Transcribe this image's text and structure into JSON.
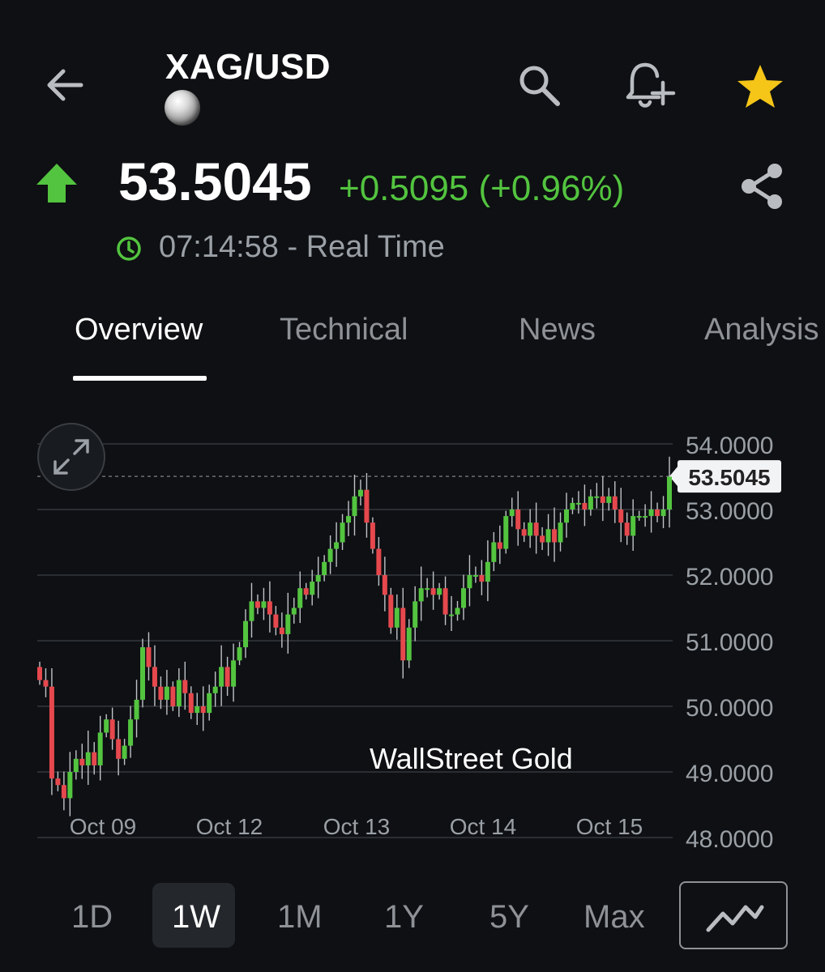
{
  "header": {
    "title": "XAG/USD",
    "back_icon": "arrow-left-icon",
    "search_icon": "search-icon",
    "alert_icon": "bell-plus-icon",
    "favorite_icon": "star-icon"
  },
  "quote": {
    "price": "53.5045",
    "change": "+0.5095 (+0.96%)",
    "timestamp": "07:14:58 - Real Time",
    "direction_icon": "arrow-up-icon",
    "up_color": "#53c43f"
  },
  "tabs": [
    {
      "label": "Overview",
      "active": true
    },
    {
      "label": "Technical",
      "active": false
    },
    {
      "label": "News",
      "active": false
    },
    {
      "label": "Analysis",
      "active": false
    }
  ],
  "chart": {
    "watermark": "WallStreet Gold",
    "current_label": "53.5045"
  },
  "ranges": [
    {
      "label": "1D",
      "active": false
    },
    {
      "label": "1W",
      "active": true
    },
    {
      "label": "1M",
      "active": false
    },
    {
      "label": "1Y",
      "active": false
    },
    {
      "label": "5Y",
      "active": false
    },
    {
      "label": "Max",
      "active": false
    }
  ],
  "chart_data": {
    "type": "candlestick",
    "x_tick_labels": [
      "Oct 09",
      "Oct 12",
      "Oct 13",
      "Oct 14",
      "Oct 15"
    ],
    "y_tick_labels": [
      "54.0000",
      "53.0000",
      "52.0000",
      "51.0000",
      "50.0000",
      "49.0000",
      "48.0000"
    ],
    "ylim": [
      48,
      54
    ],
    "current_price": 53.5045,
    "grid": true,
    "up_color": "#53c43f",
    "down_color": "#e5484d",
    "close_path": [
      50.4,
      50.3,
      48.9,
      48.8,
      48.6,
      49.0,
      49.2,
      49.1,
      49.3,
      49.1,
      49.6,
      49.8,
      49.5,
      49.2,
      49.4,
      49.8,
      50.1,
      50.9,
      50.6,
      50.3,
      50.1,
      50.3,
      50.0,
      50.4,
      50.2,
      49.9,
      50.0,
      49.9,
      50.2,
      50.3,
      50.6,
      50.3,
      50.7,
      50.9,
      51.3,
      51.6,
      51.5,
      51.6,
      51.4,
      51.2,
      51.1,
      51.4,
      51.5,
      51.8,
      51.7,
      51.9,
      52.0,
      52.2,
      52.4,
      52.5,
      52.8,
      52.9,
      53.2,
      53.3,
      52.8,
      52.4,
      52.0,
      51.7,
      51.2,
      51.5,
      50.7,
      51.2,
      51.6,
      51.8,
      51.8,
      51.7,
      51.8,
      51.4,
      51.4,
      51.5,
      51.8,
      52.0,
      52.0,
      51.9,
      52.2,
      52.5,
      52.4,
      52.9,
      53.0,
      52.7,
      52.6,
      52.8,
      52.6,
      52.5,
      52.7,
      52.5,
      52.8,
      53.0,
      53.1,
      53.1,
      53.0,
      53.2,
      53.2,
      53.1,
      53.2,
      53.0,
      52.8,
      52.6,
      52.9,
      52.9,
      52.9,
      53.0,
      52.9,
      53.0,
      53.5
    ]
  },
  "chart_type_icon": "line-chart-icon",
  "expand_icon": "expand-icon"
}
